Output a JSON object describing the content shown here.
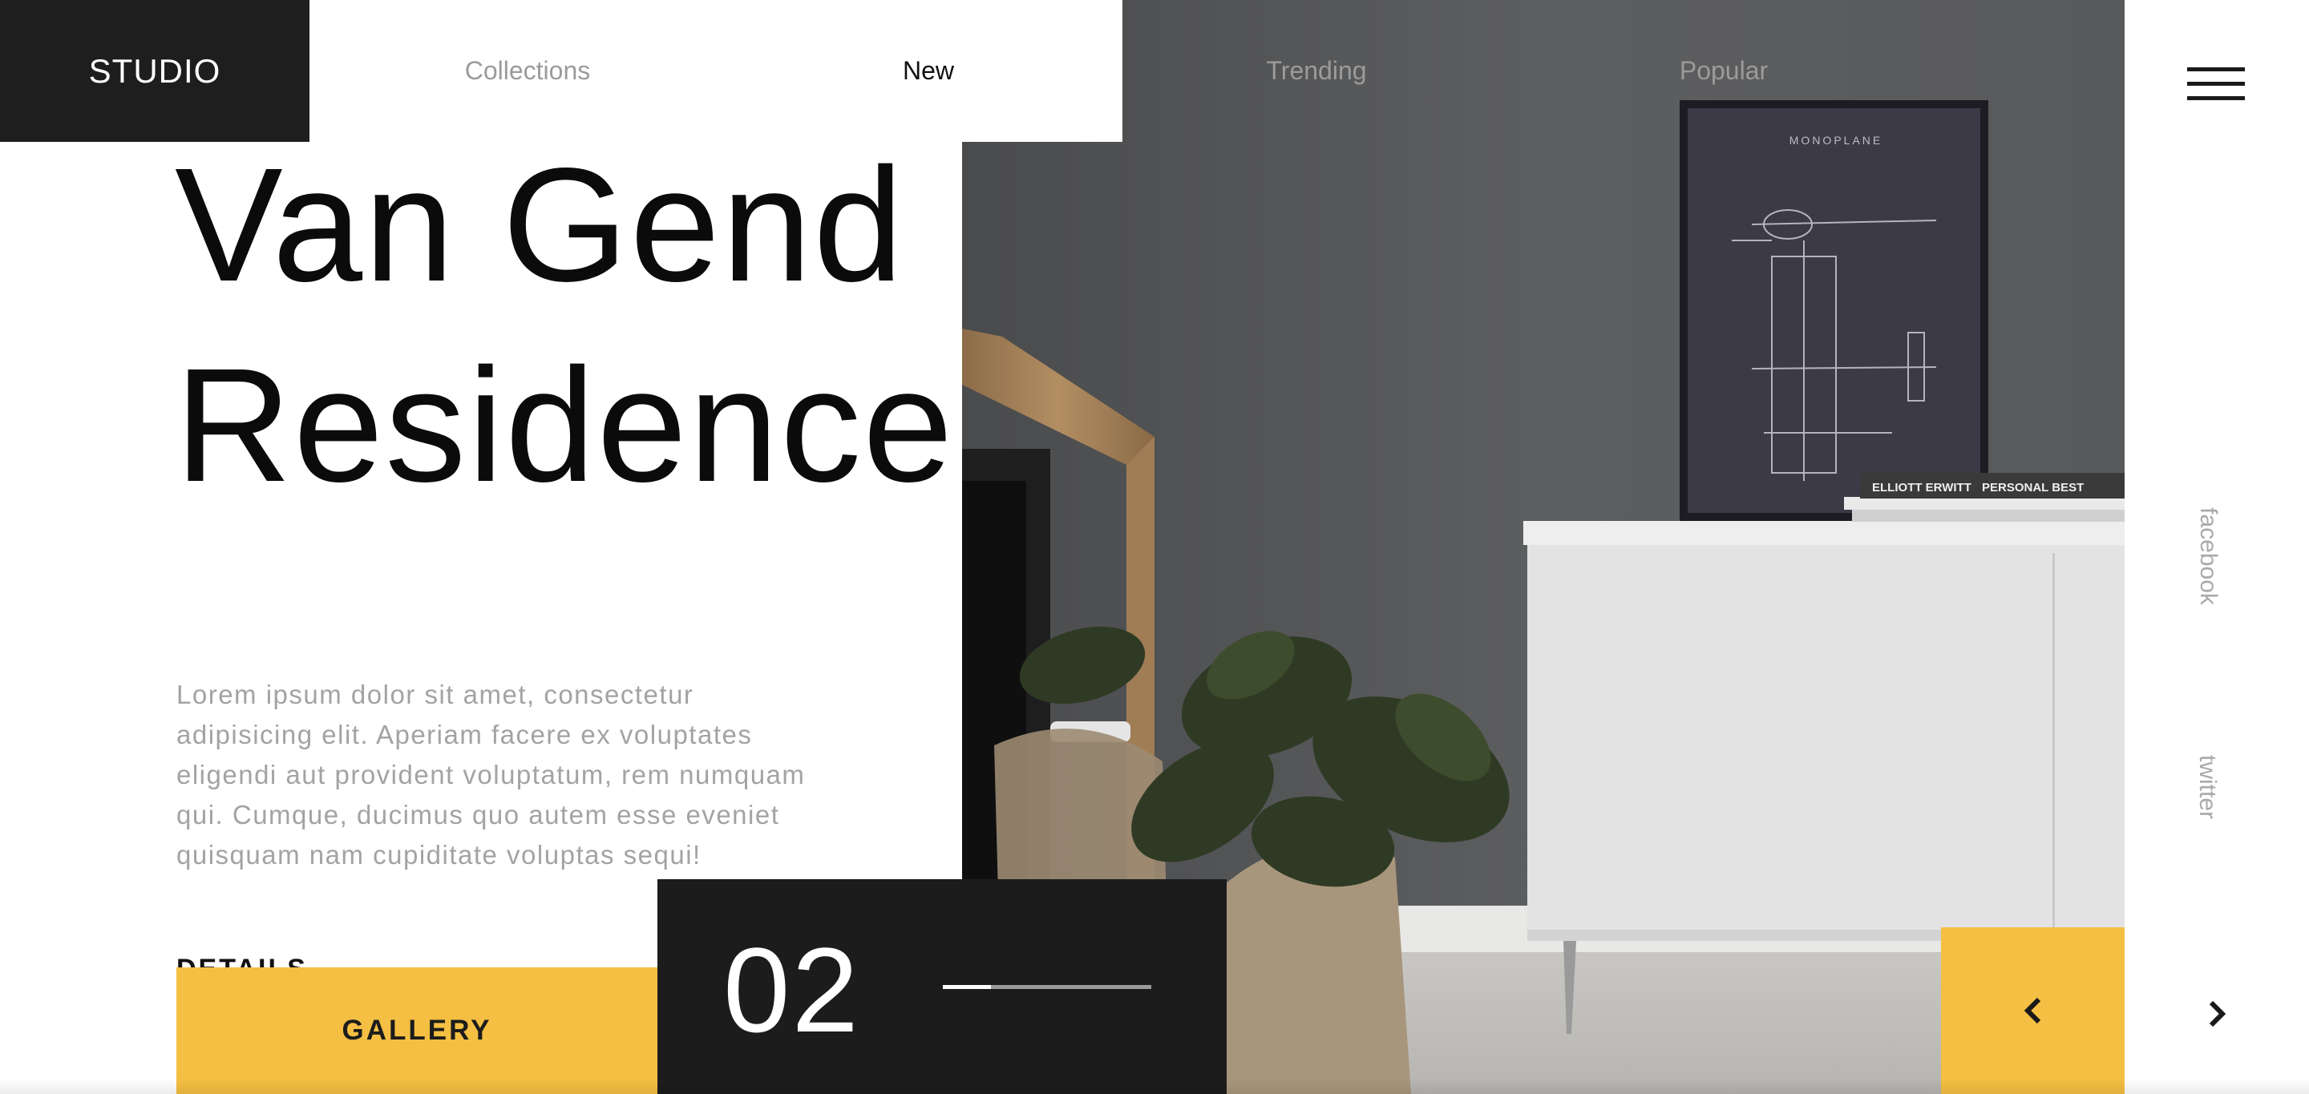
{
  "brand": {
    "name": "STUDIO"
  },
  "nav": {
    "items": [
      {
        "label": "Collections",
        "active": false
      },
      {
        "label": "New",
        "active": true
      },
      {
        "label": "Trending",
        "active": false
      },
      {
        "label": "Popular",
        "active": false
      }
    ]
  },
  "hero": {
    "title_line1": "Van Gend",
    "title_line2": "Residence",
    "description": "Lorem ipsum dolor sit amet, consectetur adipisicing elit. Aperiam facere ex voluptates eligendi aut provident voluptatum, rem numquam qui. Cumque, ducimus quo autem esse eveniet quisquam nam cupiditate voluptas sequi!",
    "details_label": "DETAILS",
    "photo_books": [
      "ELLIOTT ERWITT",
      "PERSONAL BEST"
    ],
    "photo_poster_caption": "MONOPLANE"
  },
  "gallery": {
    "label": "GALLERY"
  },
  "slider": {
    "current": "02",
    "progress": 0.23
  },
  "social": {
    "facebook": "facebook",
    "twitter": "twitter"
  },
  "icons": {
    "menu": "hamburger-menu-icon",
    "prev": "chevron-left-icon",
    "next": "chevron-right-icon"
  },
  "colors": {
    "accent": "#f4bf42",
    "dark": "#1c1c1c",
    "text_muted": "#a3a3a3"
  }
}
